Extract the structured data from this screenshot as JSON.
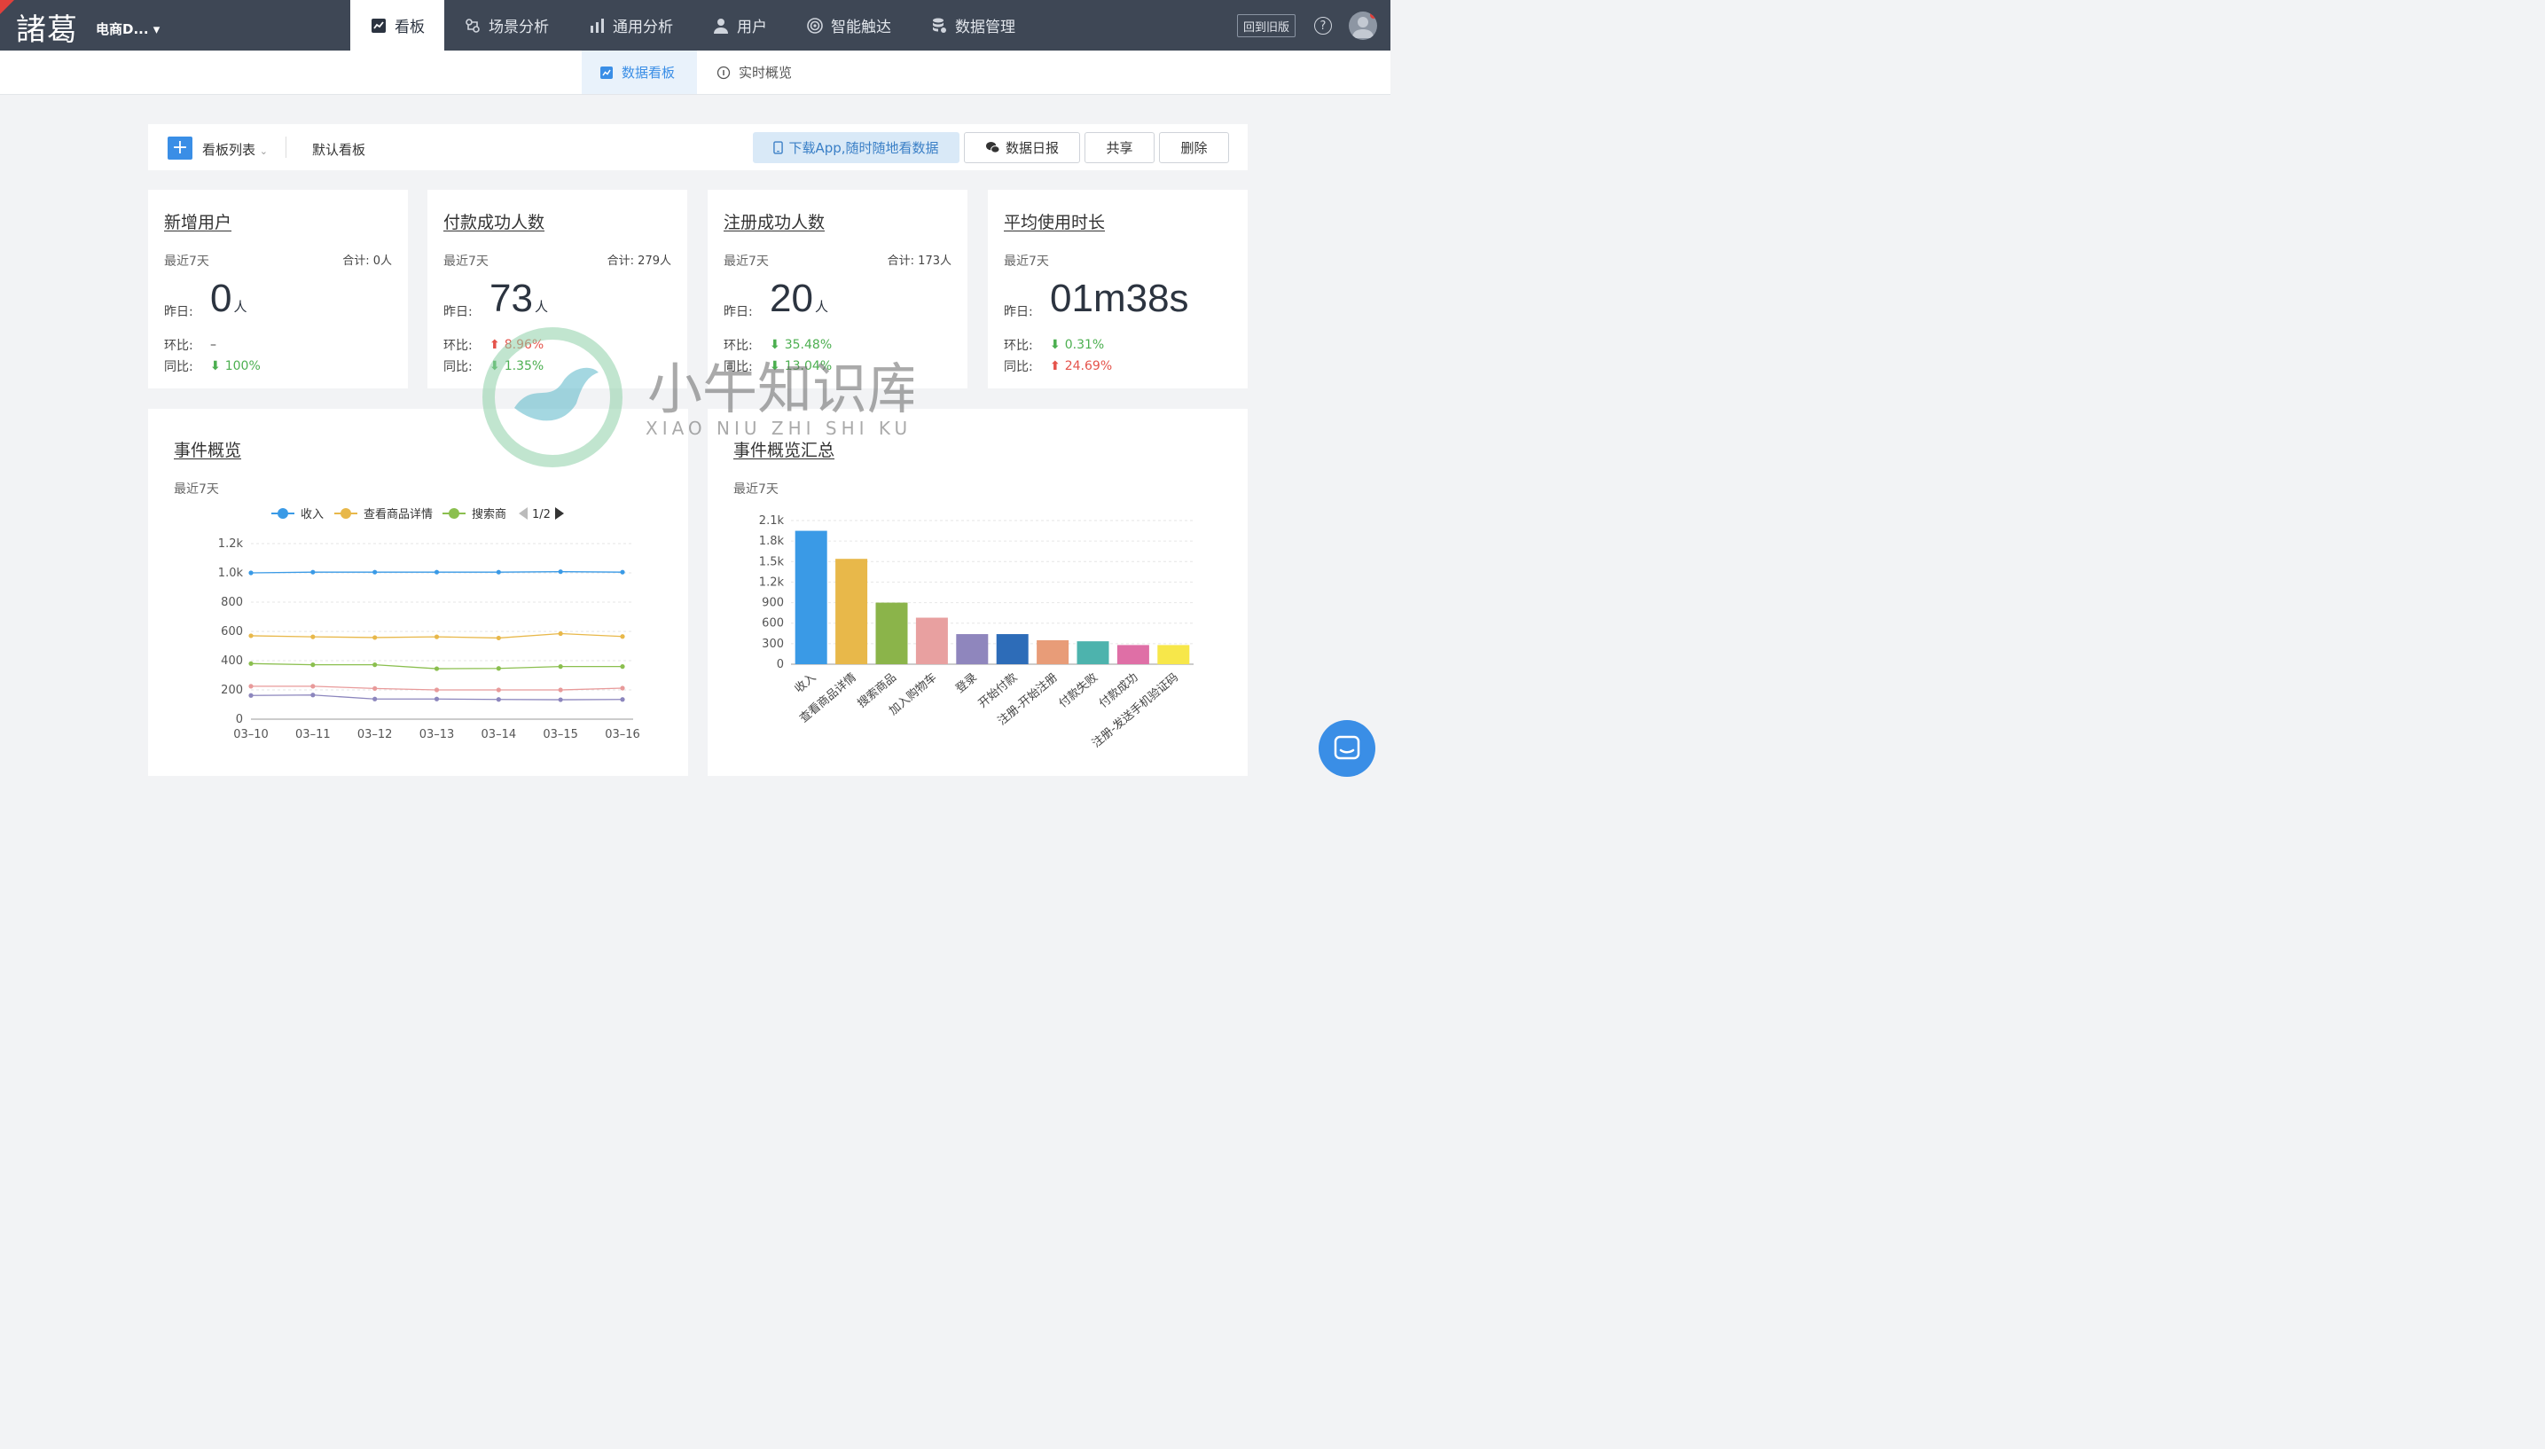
{
  "app": {
    "logo_text": "諸葛",
    "project": "电商D...",
    "back_old": "回到旧版",
    "help": "?"
  },
  "nav": [
    {
      "label": "看板",
      "icon": "dashboard-icon",
      "active": true
    },
    {
      "label": "场景分析",
      "icon": "scene-icon"
    },
    {
      "label": "通用分析",
      "icon": "bar-chart-icon"
    },
    {
      "label": "用户",
      "icon": "user-icon"
    },
    {
      "label": "智能触达",
      "icon": "target-icon"
    },
    {
      "label": "数据管理",
      "icon": "database-icon"
    }
  ],
  "subtabs": [
    {
      "label": "数据看板",
      "active": true
    },
    {
      "label": "实时概览"
    }
  ],
  "toolbar": {
    "list_label": "看板列表",
    "current_board": "默认看板",
    "app_btn": "下载App,随时随地看数据",
    "daily_btn": "数据日报",
    "share_btn": "共享",
    "delete_btn": "删除"
  },
  "kpis": [
    {
      "title": "新增用户",
      "period": "最近7天",
      "total": "合计: 0人",
      "yesterday_label": "昨日:",
      "value": "0",
      "unit": "人",
      "mom_label": "环比:",
      "mom": "–",
      "mom_dir": "none",
      "yoy_label": "同比:",
      "yoy": "100%",
      "yoy_dir": "down"
    },
    {
      "title": "付款成功人数",
      "period": "最近7天",
      "total": "合计: 279人",
      "yesterday_label": "昨日:",
      "value": "73",
      "unit": "人",
      "mom_label": "环比:",
      "mom": "8.96%",
      "mom_dir": "up",
      "yoy_label": "同比:",
      "yoy": "1.35%",
      "yoy_dir": "down"
    },
    {
      "title": "注册成功人数",
      "period": "最近7天",
      "total": "合计: 173人",
      "yesterday_label": "昨日:",
      "value": "20",
      "unit": "人",
      "mom_label": "环比:",
      "mom": "35.48%",
      "mom_dir": "down",
      "yoy_label": "同比:",
      "yoy": "13.04%",
      "yoy_dir": "down"
    },
    {
      "title": "平均使用时长",
      "period": "最近7天",
      "total": "",
      "yesterday_label": "昨日:",
      "value": "01m38s",
      "unit": "",
      "mom_label": "环比:",
      "mom": "0.31%",
      "mom_dir": "down",
      "yoy_label": "同比:",
      "yoy": "24.69%",
      "yoy_dir": "up"
    }
  ],
  "line_panel": {
    "title": "事件概览",
    "period": "最近7天",
    "legend_page": "1/2"
  },
  "bar_panel": {
    "title": "事件概览汇总",
    "period": "最近7天"
  },
  "watermark": {
    "cn": "小牛知识库",
    "en": "XIAO NIU ZHI SHI KU"
  },
  "chart_data": [
    {
      "type": "line",
      "x": [
        "03–10",
        "03–11",
        "03–12",
        "03–13",
        "03–14",
        "03–15",
        "03–16"
      ],
      "ylim": [
        0,
        1200
      ],
      "yticks": [
        "0",
        "200",
        "400",
        "600",
        "800",
        "1.0k",
        "1.2k"
      ],
      "series": [
        {
          "name": "收入",
          "color": "#3a9ae6",
          "values": [
            1000,
            1005,
            1005,
            1005,
            1005,
            1008,
            1005
          ]
        },
        {
          "name": "查看商品详情",
          "color": "#e8b84a",
          "values": [
            570,
            563,
            558,
            563,
            555,
            585,
            565
          ]
        },
        {
          "name": "搜索商品",
          "color": "#8bbf4f",
          "values": [
            380,
            372,
            372,
            345,
            347,
            360,
            360
          ]
        },
        {
          "color": "#e89a9a",
          "values": [
            225,
            225,
            210,
            200,
            200,
            200,
            212
          ]
        },
        {
          "color": "#8c86bd",
          "values": [
            162,
            165,
            138,
            138,
            135,
            133,
            135
          ]
        }
      ],
      "legend_visible": [
        "收入",
        "查看商品详情",
        "搜索商"
      ]
    },
    {
      "type": "bar",
      "categories": [
        "收入",
        "查看商品详情",
        "搜索商品",
        "加入购物车",
        "登录",
        "开始付款",
        "注册-开始注册",
        "付款失败",
        "付款成功",
        "注册-发送手机验证码"
      ],
      "values": [
        1950,
        1540,
        900,
        680,
        440,
        440,
        350,
        335,
        280,
        280
      ],
      "colors": [
        "#3a9ae6",
        "#e8b84a",
        "#8bb44a",
        "#e8a0a0",
        "#8f86bd",
        "#2d6cb8",
        "#e89c78",
        "#4db3ad",
        "#df6fa6",
        "#f7e74a"
      ],
      "ylim": [
        0,
        2100
      ],
      "yticks": [
        "0",
        "300",
        "600",
        "900",
        "1.2k",
        "1.5k",
        "1.8k",
        "2.1k"
      ]
    }
  ]
}
